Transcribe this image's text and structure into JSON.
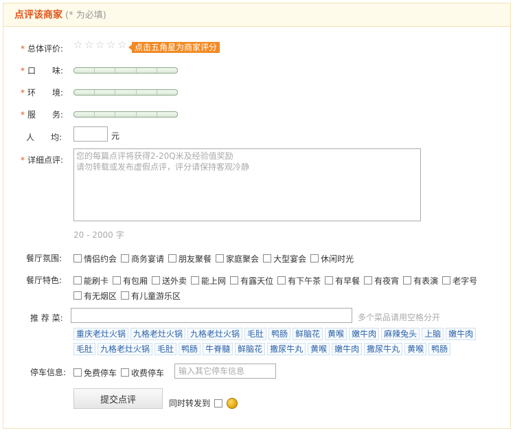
{
  "header": {
    "title": "点评该商家",
    "note": "(* 为必填)"
  },
  "overall": {
    "label": "总体评价:",
    "tip": "点击五角星为商家评分",
    "stars": 5
  },
  "taste": {
    "label": "口　　味:"
  },
  "environment": {
    "label": "环　　境:"
  },
  "service": {
    "label": "服　　务:"
  },
  "average": {
    "label": "人　　均:",
    "unit": "元",
    "value": ""
  },
  "detail": {
    "label": "详细点评:",
    "placeholder": "您的每篇点评将获得2-20Q米及经验值奖励\n请勿转载或发布虚假点评，评分请保持客观冷静",
    "count": "20 - 2000 字"
  },
  "atmosphere": {
    "label": "餐厅氛围:",
    "options": [
      "情侣约会",
      "商务宴请",
      "朋友聚餐",
      "家庭聚会",
      "大型宴会",
      "休闲时光"
    ]
  },
  "features": {
    "label": "餐厅特色:",
    "options": [
      "能刷卡",
      "有包厢",
      "送外卖",
      "能上网",
      "有露天位",
      "有下午茶",
      "有早餐",
      "有夜宵",
      "有表演",
      "老字号",
      "有无烟区",
      "有儿童游乐区"
    ]
  },
  "dishes": {
    "label": "推 荐 菜:",
    "hint": "多个菜品请用空格分开",
    "tags": [
      "重庆老灶火锅",
      "九格老灶火锅",
      "九格老灶火锅",
      "毛肚",
      "鸭肠",
      "鲜脑花",
      "黄喉",
      "嫩牛肉",
      "麻辣兔头",
      "上脑",
      "嫩牛肉",
      "毛肚",
      "九格老灶火锅",
      "毛肚",
      "鸭肠",
      "牛脊髓",
      "鲜脑花",
      "撒尿牛丸",
      "黄喉",
      "嫩牛肉",
      "撒尿牛丸",
      "黄喉",
      "鸭肠"
    ]
  },
  "parking": {
    "label": "停车信息:",
    "options": [
      "免费停车",
      "收费停车"
    ],
    "placeholder": "输入其它停车信息"
  },
  "submit": {
    "label": "提交点评",
    "share_label": "同时转发到"
  }
}
